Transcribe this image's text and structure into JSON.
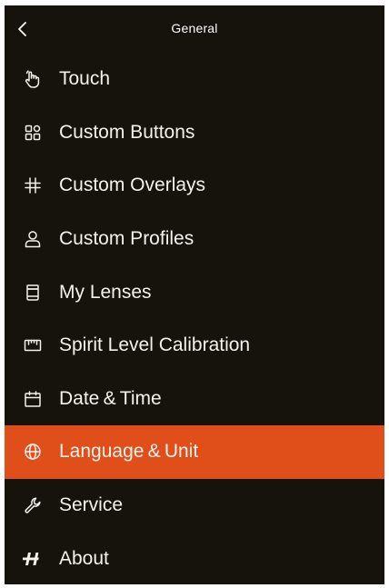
{
  "header": {
    "title": "General",
    "back_icon": "chevron-left-icon"
  },
  "menu": {
    "items": [
      {
        "label": "Touch",
        "icon": "touch-hand-icon",
        "active": false
      },
      {
        "label": "Custom Buttons",
        "icon": "grid-buttons-icon",
        "active": false
      },
      {
        "label": "Custom Overlays",
        "icon": "hash-grid-icon",
        "active": false
      },
      {
        "label": "Custom Profiles",
        "icon": "person-icon",
        "active": false
      },
      {
        "label": "My Lenses",
        "icon": "lens-icon",
        "active": false
      },
      {
        "label": "Spirit Level Calibration",
        "icon": "spirit-level-icon",
        "active": false
      },
      {
        "label": "Date & Time",
        "icon": "calendar-icon",
        "active": false
      },
      {
        "label": "Language & Unit",
        "icon": "globe-icon",
        "active": true
      },
      {
        "label": "Service",
        "icon": "wrench-icon",
        "active": false
      },
      {
        "label": "About",
        "icon": "brand-h-icon",
        "active": false
      }
    ]
  },
  "colors": {
    "background": "#15130c",
    "accent": "#e04f1a",
    "text": "#f4f2ec"
  }
}
